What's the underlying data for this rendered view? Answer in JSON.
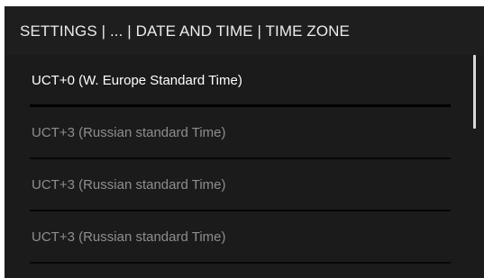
{
  "header": {
    "title": "SETTINGS | ... | DATE AND TIME | TIME ZONE"
  },
  "timezones": [
    {
      "label": "UCT+0  (W. Europe Standard Time)",
      "selected": true
    },
    {
      "label": "UCT+3  (Russian standard Time)",
      "selected": false
    },
    {
      "label": "UCT+3  (Russian standard Time)",
      "selected": false
    },
    {
      "label": "UCT+3  (Russian standard Time)",
      "selected": false
    }
  ],
  "colors": {
    "background": "#1e1e1e",
    "selected_text": "#ffffff",
    "unselected_text": "#8e8e8e",
    "divider": "#070707",
    "scrollbar": "#d8d8d8"
  }
}
